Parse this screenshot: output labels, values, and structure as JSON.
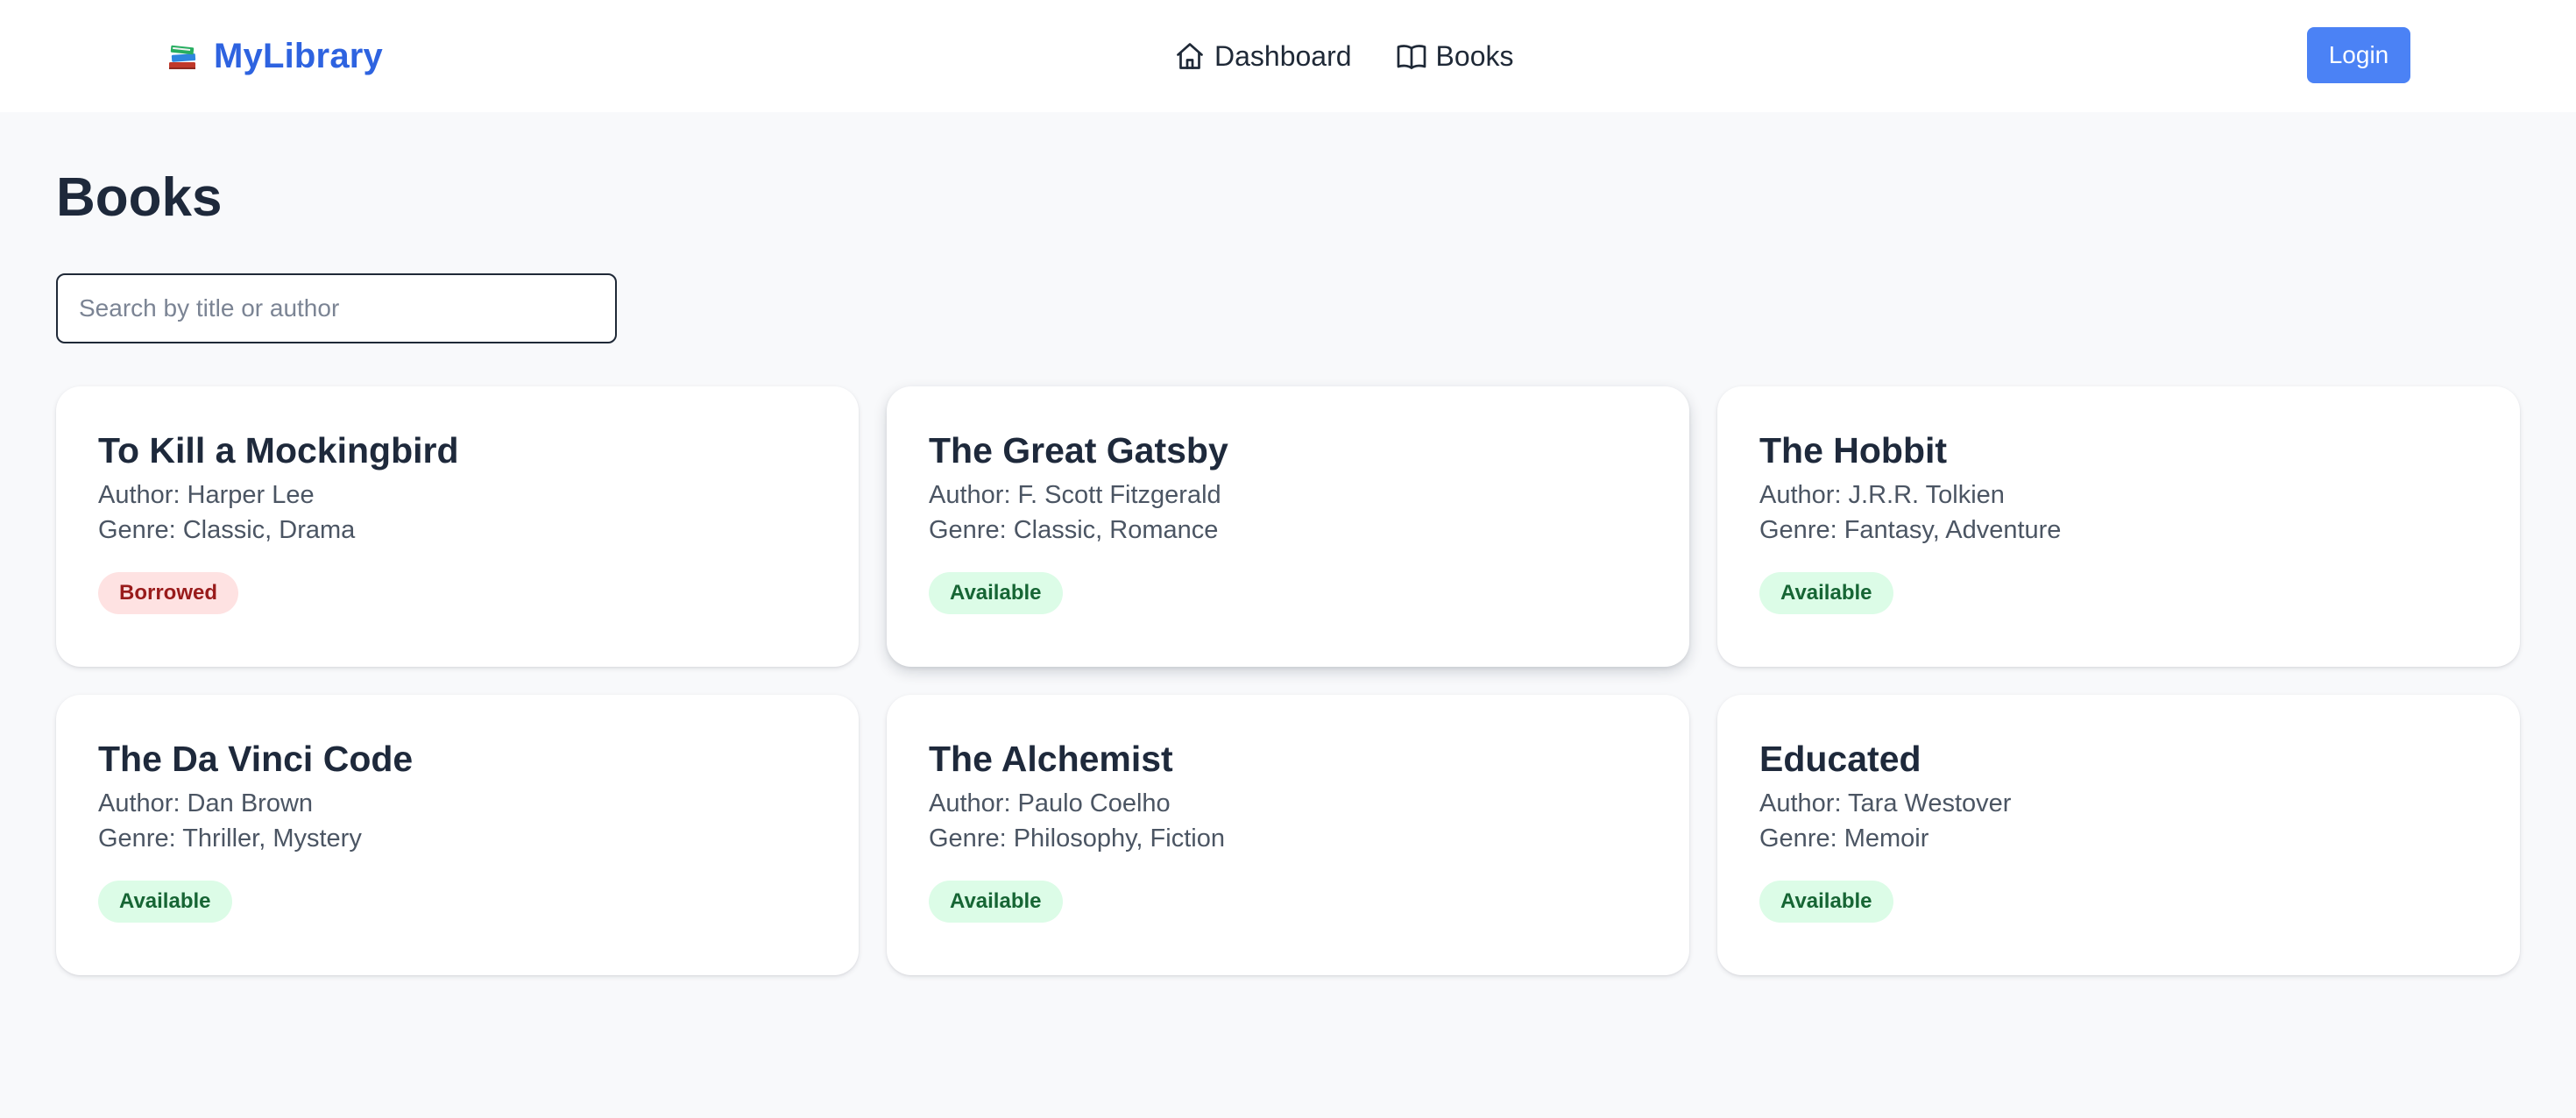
{
  "header": {
    "brand": "MyLibrary",
    "brand_icon": "books-stack-icon",
    "nav": [
      {
        "label": "Dashboard",
        "icon": "home-icon"
      },
      {
        "label": "Books",
        "icon": "open-book-icon"
      }
    ],
    "login_label": "Login"
  },
  "page": {
    "title": "Books"
  },
  "search": {
    "placeholder": "Search by title or author",
    "value": ""
  },
  "books": [
    {
      "title": "To Kill a Mockingbird",
      "author": "Author: Harper Lee",
      "genre": "Genre: Classic, Drama",
      "status": "Borrowed"
    },
    {
      "title": "The Great Gatsby",
      "author": "Author: F. Scott Fitzgerald",
      "genre": "Genre: Classic, Romance",
      "status": "Available"
    },
    {
      "title": "The Hobbit",
      "author": "Author: J.R.R. Tolkien",
      "genre": "Genre: Fantasy, Adventure",
      "status": "Available"
    },
    {
      "title": "The Da Vinci Code",
      "author": "Author: Dan Brown",
      "genre": "Genre: Thriller, Mystery",
      "status": "Available"
    },
    {
      "title": "The Alchemist",
      "author": "Author: Paulo Coelho",
      "genre": "Genre: Philosophy, Fiction",
      "status": "Available"
    },
    {
      "title": "Educated",
      "author": "Author: Tara Westover",
      "genre": "Genre: Memoir",
      "status": "Available"
    }
  ],
  "colors": {
    "brand": "#2e63e0",
    "login_button": "#4b82f5",
    "available_bg": "#dcfce7",
    "available_text": "#166534",
    "borrowed_bg": "#fee2e2",
    "borrowed_text": "#991b1b"
  }
}
